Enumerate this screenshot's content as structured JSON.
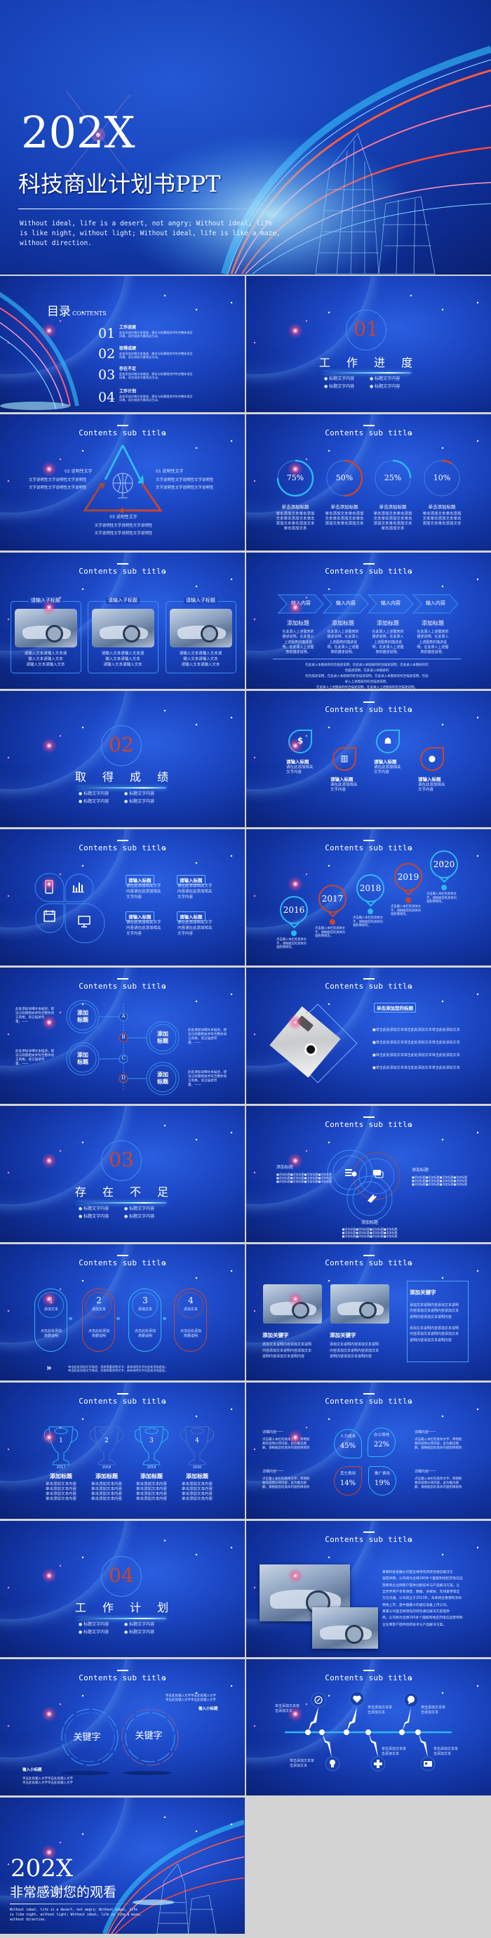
{
  "colors": {
    "accent_red": "#c8462e",
    "accent_cyan": "#2fb6f3",
    "background_blue": "#1c47c4",
    "empty_cell": "#d3d3d3"
  },
  "hero": {
    "year": "202X",
    "title": "科技商业计划书PPT",
    "tagline": "Without ideal, life is a desert, not angry; Without ideal, life\nis like night, without light; Without ideal, life is like a maze,\nwithout direction."
  },
  "common": {
    "sub_title": "Contents sub title"
  },
  "toc": {
    "title": "目录",
    "subtitle": "CONTENTS",
    "items": [
      {
        "num": "01",
        "title": "工作进度",
        "desc": "此处添加详细文本描述，建议与标题相关并符合整体语言\n风格，语言描述尽量简洁生动。"
      },
      {
        "num": "02",
        "title": "取得成绩",
        "desc": "此处添加详细文本描述，建议与标题相关并符合整体语言\n风格，语言描述尽量简洁生动。"
      },
      {
        "num": "03",
        "title": "存在不足",
        "desc": "此处添加详细文本描述，建议与标题相关并符合整体语言\n风格，语言描述尽量简洁生动。"
      },
      {
        "num": "04",
        "title": "工作计划",
        "desc": "此处添加详细文本描述，建议与标题相关并符合整体语言\n风格，语言描述尽量简洁生动。"
      }
    ]
  },
  "sections": [
    {
      "num": "01",
      "title": "工 作 进 度",
      "bullets": [
        "● 标题文字内容",
        "● 标题文字内容",
        "● 标题文字内容",
        "● 标题文字内容"
      ]
    },
    {
      "num": "02",
      "title": "取 得 成 绩",
      "bullets": [
        "● 标题文字内容",
        "● 标题文字内容",
        "● 标题文字内容",
        "● 标题文字内容"
      ]
    },
    {
      "num": "03",
      "title": "存 在 不 足",
      "bullets": [
        "● 标题文字内容",
        "● 标题文字内容",
        "● 标题文字内容",
        "● 标题文字内容"
      ]
    },
    {
      "num": "04",
      "title": "工 作 计 划",
      "bullets": [
        "● 标题文字内容",
        "● 标题文字内容",
        "● 标题文字内容",
        "● 标题文字内容"
      ]
    }
  ],
  "triangle": {
    "items": [
      {
        "label": "01 说明性文字",
        "text": "文字说明性文字说明性文字说明性\n文字说明性文字说明性文字说明性"
      },
      {
        "label": "02 说明性文字",
        "text": "文字说明性文字说明性文字说明性\n文字说明性文字说明性文字说明性"
      },
      {
        "label": "03 说明性文字",
        "text": "文字说明性文字说明性文字说明性\n文字说明性文字说明性文字说明性"
      }
    ]
  },
  "progress": {
    "items": [
      {
        "percent": 75,
        "label": "75%",
        "title": "单击添加标题",
        "text": "单击添加文本单击添加\n文本单击添加文本单击\n添加文本单击添加文本\n单击添加文本"
      },
      {
        "percent": 50,
        "label": "50%",
        "title": "单击添加标题",
        "text": "单击添加文本单击添加\n文本单击添加文本单击\n添加文本单击添加文本"
      },
      {
        "percent": 25,
        "label": "25%",
        "title": "单击添加标题",
        "text": "单击添加文本单击添加\n文本单击添加文本单击\n添加文本单击添加文本\n单击添加文本"
      },
      {
        "percent": 10,
        "label": "10%",
        "title": "单击添加标题",
        "text": "单击添加文本单击添加\n文本单击添加文本单击\n添加文本单击添加文本"
      }
    ]
  },
  "cards": {
    "items": [
      {
        "label": "请输入子标题",
        "text": "请输入文本请输入文本请\n输入文本请输入文本\n请输入文本请输入文本"
      },
      {
        "label": "请输入子标题",
        "text": "请输入文本请输入文本请\n输入文本请输入文本\n请输入文本请输入文本"
      },
      {
        "label": "请输入子标题",
        "text": "请输入文本请输入文本请\n输入文本请输入文本\n请输入文本请输入文本"
      }
    ]
  },
  "process": {
    "steps": [
      "输入内容",
      "输入内容",
      "输入内容",
      "输入内容"
    ],
    "titles": [
      "添加标题",
      "添加标题",
      "添加标题",
      "添加标题"
    ],
    "texts": [
      "在此录入上述图表的\n描述说明，在此录入\n上述图表的描述说\n明，在此录入上述图\n表的描述说明。",
      "在此录入上述图表的\n描述说明，在此录入\n上述图表的描述说\n明，在此录入上述图\n表的描述说明。",
      "在此录入上述图表的\n描述说明，在此录入\n上述图表的描述说\n明，在此录入上述图\n表的描述说明。",
      "在此录入上述图表的\n描述说明，在此录入\n上述图表的描述说\n明，在此录入上述图\n表的描述说明。"
    ],
    "summary": "在此录入本图表的综合描述说明，在此录入本图表的综合描述说明，在此录入本图表的综合描述说明，在此录入本图表的\n综合描述说明，在此录入本图表的综合描述说明，在此录入本图表的综合描述说明，在此录入上述图表的综合描述说明，\n在此录入上述图表的综合描述说明，在此录入上述图表的综合描述说明。"
  },
  "drops": {
    "items": [
      {
        "icon": "money-person-icon",
        "title": "请输入标题",
        "text": "请在此添加相关\n文字内容"
      },
      {
        "icon": "presenter-icon",
        "title": "请输入标题",
        "text": "请在此添加相关\n文字内容"
      },
      {
        "icon": "team-icon",
        "title": "请输入标题",
        "text": "请在此添加相关\n文字内容"
      },
      {
        "icon": "user-icon",
        "title": "请输入标题",
        "text": "请在此添加相关\n文字内容"
      }
    ]
  },
  "petals": {
    "icons": [
      "phone-icon",
      "bar-chart-icon",
      "calendar-icon",
      "monitor-icon"
    ],
    "items": [
      {
        "title": "请输入标题",
        "text": "请在此添加相关文字\n内容请在此添加相关\n文字内容"
      },
      {
        "title": "请输入标题",
        "text": "请在此添加相关文字\n内容请在此添加相关\n文字内容"
      },
      {
        "title": "请输入标题",
        "text": "请在此添加相关文字\n内容请在此添加相关\n文字内容"
      },
      {
        "title": "请输入标题",
        "text": "请在此添加相关文字\n内容请在此添加相关\n文字内容"
      }
    ]
  },
  "timeline": {
    "items": [
      {
        "year": "2016",
        "text": "点击输入本栏的具体文\n字，请根据您的具体内\n容酌情修改。"
      },
      {
        "year": "2017",
        "text": "点击输入本栏的具体文\n字，请根据您的具体内\n容酌情修改。"
      },
      {
        "year": "2018",
        "text": "点击输入本栏的具体文\n字，请根据您的具体内\n容酌情修改。"
      },
      {
        "year": "2019",
        "text": "点击输入本栏的具体文\n字，请根据您的具体内\n容酌情修改。"
      },
      {
        "year": "2020",
        "text": "点击输入本栏的具体文\n字，请根据您的具体内\n容酌情修改。"
      }
    ]
  },
  "abcd": {
    "letters": [
      "A",
      "B",
      "C",
      "D"
    ],
    "bubbles": [
      "添加\n标题",
      "添加\n标题",
      "添加\n标题",
      "添加\n标题"
    ],
    "texts": [
      "此处添加详细文本描述，建\n议与标题相关并符合整体语\n言风格，语言描述尽\n量。一一",
      "此处添加详细文本描述，建\n议与标题相关并符合整体语\n言风格，语言描述尽\n量。一一",
      "此处添加详细文本描述，建\n议与标题相关并符合整体语\n言风格，语言描述尽\n量。一一",
      "此处添加详细文本描述，建\n议与标题相关并符合整体语\n言风格，语言描述尽\n量。一一"
    ]
  },
  "photo_list": {
    "title": "单击添加您的标题",
    "bullets": [
      "■单击此处添加文本单击此处添加文本单击此处添加文本",
      "■单击此处添加文本单击此处添加文本单击此处添加文本",
      "■单击此处添加文本单击此处添加文本单击此处添加文本",
      "■单击此处添加文本单击此处添加文本单击此处添加文本"
    ]
  },
  "venn": {
    "labels": [
      "添加标题",
      "添加标题",
      "添加标题"
    ],
    "text": "■添加标题■添加标题■添加标题■添加标题\n■添加标题■添加标题■添加标题■添加标题\n■添加标题■添加标题■添加标题■添加标题"
  },
  "pills": {
    "items": [
      {
        "num": "1",
        "label": "添加文本",
        "text": "点击此处添加\n简要说明"
      },
      {
        "num": "2",
        "label": "添加文本",
        "text": "点击此处添加\n简要说明"
      },
      {
        "num": "3",
        "label": "添加文本",
        "text": "点击此处添加\n简要说明"
      },
      {
        "num": "4",
        "label": "添加文本",
        "text": "点击此处添加\n简要说明"
      }
    ],
    "footer": "单击此处添加文字描述，添加简要说明文字，具体说明文字在此处添加此处。\n单击此处添加文字描述，添加简要说明文字，具体说明文字在此处添加此处。"
  },
  "keywords": {
    "items": [
      {
        "title": "添加关键字",
        "text": "添加文本说明内容添加文本说明\n内容添加文本说明内容添加文本\n说明内容添加文本说明内容"
      },
      {
        "title": "添加关键字",
        "text": "添加文本说明内容添加文本说明\n内容添加文本说明内容添加文本\n说明内容添加文本说明内容"
      }
    ],
    "box_title": "添加关键字",
    "box_text": "添加文本说明内容添加文本说明\n内容添加文本说明内容添加文本\n说明内容添加文本说明内容\n\n添加文本说明内容添加文本说明\n内容添加文本说明内容添加文本\n说明内容添加文本说明内容"
  },
  "trophies": {
    "items": [
      {
        "num": "1",
        "year": "2017",
        "title": "添加标题",
        "text": "单击添加文本内容\n单击添加文本内容\n单击添加文本内容\n单击添加文本内容"
      },
      {
        "num": "2",
        "year": "2018",
        "title": "添加标题",
        "text": "单击添加文本内容\n单击添加文本内容\n单击添加文本内容\n单击添加文本内容"
      },
      {
        "num": "3",
        "year": "2019",
        "title": "添加标题",
        "text": "单击添加文本内容\n单击添加文本内容\n单击添加文本内容\n单击添加文本内容"
      },
      {
        "num": "4",
        "year": "2020",
        "title": "添加标题",
        "text": "单击添加文本内容\n单击添加文本内容\n单击添加文本内容\n单击添加文本内容"
      }
    ]
  },
  "costs": {
    "items": [
      {
        "label": "人力成本",
        "value": "45%"
      },
      {
        "label": "办公场地",
        "value": "22%"
      },
      {
        "label": "其它费用",
        "value": "14%"
      },
      {
        "label": "推广费用",
        "value": "19%"
      }
    ],
    "detail_title": "详细内容一一",
    "detail_text": "点击输入本栏的具体文字，简明扼\n要的说明分项内容，此为概念图\n解，请根据您的具体内容酌情修改"
  },
  "about": {
    "text": "某某科技发展公司是全球领先的综合通信解决方\n案提供商。公司将为全球160多个国家和地区的电信运\n营商和企业网客户提供创新技术与产品解决方案，让\n全世界用户享有语音、数据、多媒体、无线宽带等全\n方位沟通。公司成立于2013年，未来将在香港和深圳\n两地上市，是中国最大的通信设备上市公司。\n    某某公司是全球领先的综合通信解决方案提供\n商。公司将为全球160多个国家和地区的电信运营商和\n企业网客户提供创新技术与产品解决方案。"
  },
  "rings": {
    "keywords": [
      "关键字",
      "关键字"
    ],
    "subtitle": "输入小标题",
    "text": "单击此处输入文字单击此处输入文字\n单击此处输入文字单击此处输入文字"
  },
  "icon_timeline": {
    "icons": [
      "compass-icon",
      "lightbulb-icon",
      "heart-icon",
      "plus-icon",
      "chat-icon",
      "id-card-icon"
    ],
    "text": "单击添加文本单\n击添加文本"
  },
  "closing": {
    "year": "202X",
    "title": "非常感谢您的观看",
    "tagline": "Without ideal, life is a desert, not angry; Without ideal, life\nis like night, without light; Without ideal, life is like a maze,\nwithout direction."
  }
}
